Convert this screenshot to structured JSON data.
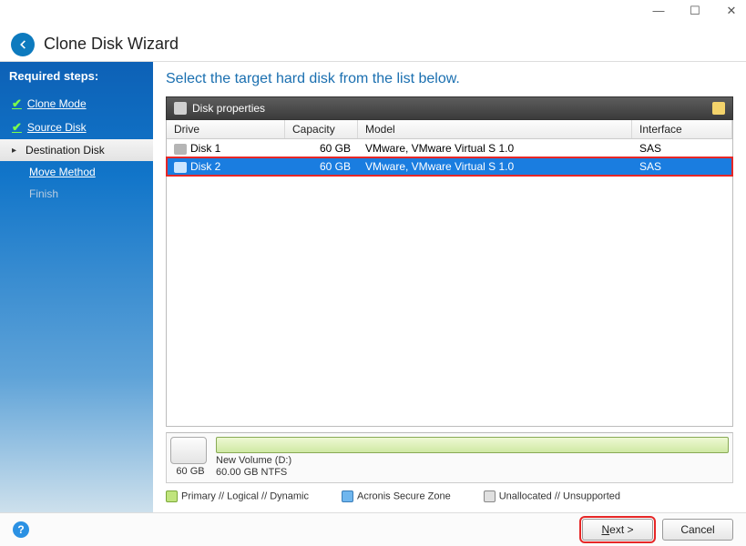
{
  "window": {
    "title": "Clone Disk Wizard"
  },
  "sidebar": {
    "heading": "Required steps:",
    "steps": [
      {
        "label": "Clone Mode",
        "state": "done"
      },
      {
        "label": "Source Disk",
        "state": "done"
      },
      {
        "label": "Destination Disk",
        "state": "current"
      },
      {
        "label": "Move Method",
        "state": "pending"
      },
      {
        "label": "Finish",
        "state": "disabled"
      }
    ]
  },
  "main": {
    "heading": "Select the target hard disk from the list below.",
    "panel_label": "Disk properties",
    "columns": {
      "drive": "Drive",
      "capacity": "Capacity",
      "model": "Model",
      "interface": "Interface"
    },
    "rows": [
      {
        "drive": "Disk 1",
        "capacity": "60 GB",
        "model": "VMware, VMware Virtual S 1.0",
        "interface": "SAS",
        "selected": false
      },
      {
        "drive": "Disk 2",
        "capacity": "60 GB",
        "model": "VMware, VMware Virtual S 1.0",
        "interface": "SAS",
        "selected": true
      }
    ],
    "preview": {
      "disk_size": "60 GB",
      "volume_name": "New Volume (D:)",
      "volume_detail": "60.00 GB  NTFS"
    },
    "legend": {
      "primary": "Primary // Logical // Dynamic",
      "acronis": "Acronis Secure Zone",
      "unalloc": "Unallocated // Unsupported"
    }
  },
  "footer": {
    "next": "Next >",
    "cancel": "Cancel"
  }
}
